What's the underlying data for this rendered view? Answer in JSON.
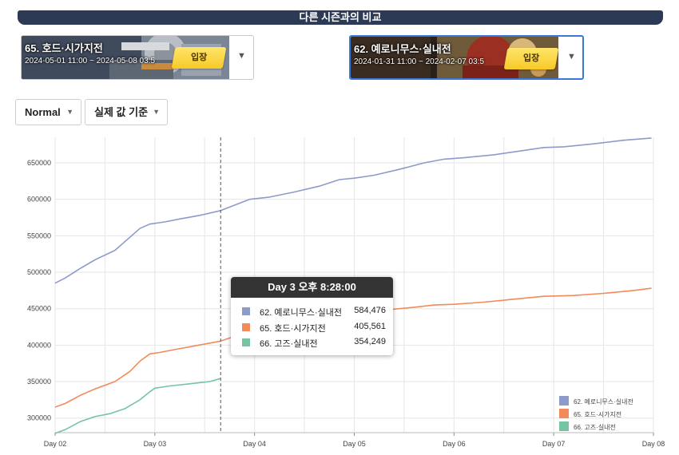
{
  "header": {
    "title": "다른 시즌과의 비교"
  },
  "cards": [
    {
      "title": "65. 호드·시가지전",
      "dates": "2024-05-01 11:00 ~ 2024-05-08 03:5",
      "button": "입장",
      "selected": false
    },
    {
      "title": "62. 예로니무스·실내전",
      "dates": "2024-01-31 11:00 ~ 2024-02-07 03:5",
      "button": "입장",
      "selected": true
    }
  ],
  "filters": {
    "mode": "Normal",
    "basis": "실제 값 기준"
  },
  "tooltip": {
    "title": "Day 3 오후 8:28:00",
    "rows": [
      {
        "name": "62. 예로니무스·실내전",
        "value": "584,476",
        "color": "#8c9bc9"
      },
      {
        "name": "65. 호드·시가지전",
        "value": "405,561",
        "color": "#f28a5b"
      },
      {
        "name": "66. 고즈·실내전",
        "value": "354,249",
        "color": "#76c4a2"
      }
    ]
  },
  "chart_data": {
    "type": "line",
    "ylim": [
      280000,
      685000
    ],
    "xlim": [
      2,
      8
    ],
    "yticks": [
      300000,
      350000,
      400000,
      450000,
      500000,
      550000,
      600000,
      650000
    ],
    "xtick_labels": [
      "Day 02",
      "Day 03",
      "Day 04",
      "Day 05",
      "Day 06",
      "Day 07",
      "Day 08"
    ],
    "cursor_x": 3.66,
    "series": [
      {
        "name": "62. 예로니무스·실내전",
        "color": "#8c9bc9",
        "points": [
          [
            2.0,
            485000
          ],
          [
            2.1,
            492000
          ],
          [
            2.25,
            505000
          ],
          [
            2.4,
            517000
          ],
          [
            2.6,
            530000
          ],
          [
            2.75,
            548000
          ],
          [
            2.85,
            560000
          ],
          [
            2.95,
            566000
          ],
          [
            3.1,
            569000
          ],
          [
            3.25,
            573000
          ],
          [
            3.45,
            578000
          ],
          [
            3.66,
            584476
          ],
          [
            3.8,
            592000
          ],
          [
            3.95,
            600000
          ],
          [
            4.15,
            603000
          ],
          [
            4.4,
            610000
          ],
          [
            4.65,
            618000
          ],
          [
            4.85,
            627000
          ],
          [
            5.0,
            629000
          ],
          [
            5.2,
            633000
          ],
          [
            5.45,
            641000
          ],
          [
            5.7,
            650000
          ],
          [
            5.9,
            655000
          ],
          [
            6.1,
            657000
          ],
          [
            6.4,
            661000
          ],
          [
            6.6,
            665000
          ],
          [
            6.9,
            671000
          ],
          [
            7.1,
            672000
          ],
          [
            7.4,
            676000
          ],
          [
            7.7,
            681000
          ],
          [
            7.98,
            684000
          ]
        ]
      },
      {
        "name": "65. 호드·시가지전",
        "color": "#f28a5b",
        "points": [
          [
            2.0,
            315000
          ],
          [
            2.1,
            320000
          ],
          [
            2.25,
            331000
          ],
          [
            2.4,
            340000
          ],
          [
            2.6,
            350000
          ],
          [
            2.75,
            364000
          ],
          [
            2.85,
            378000
          ],
          [
            2.95,
            388000
          ],
          [
            3.05,
            390000
          ],
          [
            3.2,
            394000
          ],
          [
            3.4,
            399000
          ],
          [
            3.66,
            405561
          ],
          [
            3.8,
            412000
          ],
          [
            4.0,
            420000
          ],
          [
            4.2,
            427000
          ],
          [
            4.4,
            433000
          ],
          [
            4.6,
            438000
          ],
          [
            4.8,
            442000
          ],
          [
            5.0,
            444000
          ],
          [
            5.3,
            448000
          ],
          [
            5.6,
            452000
          ],
          [
            5.8,
            455000
          ],
          [
            6.0,
            456000
          ],
          [
            6.3,
            459000
          ],
          [
            6.6,
            463000
          ],
          [
            6.9,
            467000
          ],
          [
            7.2,
            468000
          ],
          [
            7.5,
            471000
          ],
          [
            7.8,
            475000
          ],
          [
            7.98,
            478000
          ]
        ]
      },
      {
        "name": "66. 고즈·실내전",
        "color": "#76c4a2",
        "points": [
          [
            2.0,
            279000
          ],
          [
            2.1,
            284000
          ],
          [
            2.25,
            295000
          ],
          [
            2.4,
            302000
          ],
          [
            2.55,
            306000
          ],
          [
            2.7,
            313000
          ],
          [
            2.85,
            325000
          ],
          [
            2.95,
            336000
          ],
          [
            3.0,
            341000
          ],
          [
            3.15,
            344000
          ],
          [
            3.35,
            347000
          ],
          [
            3.55,
            350000
          ],
          [
            3.66,
            354249
          ]
        ]
      }
    ]
  }
}
